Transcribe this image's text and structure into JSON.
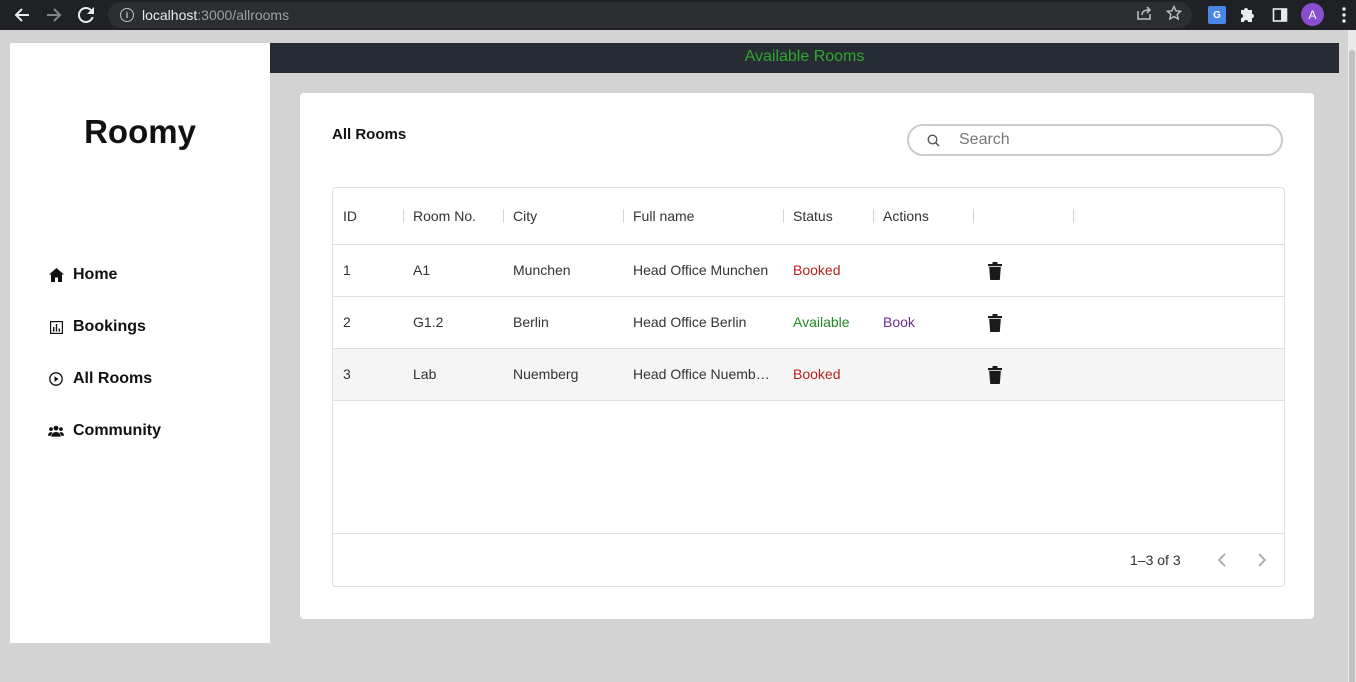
{
  "browser": {
    "url_host": "localhost",
    "url_path": ":3000/allrooms",
    "avatar_letter": "A",
    "translate_label": "G"
  },
  "sidebar": {
    "brand": "Roomy",
    "items": [
      {
        "label": "Home",
        "icon": "home-icon"
      },
      {
        "label": "Bookings",
        "icon": "bar-chart-icon"
      },
      {
        "label": "All Rooms",
        "icon": "play-circle-icon"
      },
      {
        "label": "Community",
        "icon": "people-icon"
      }
    ]
  },
  "header": {
    "title": "Available Rooms",
    "title_color": "#2ea82e"
  },
  "main": {
    "title": "All Rooms",
    "search": {
      "placeholder": "Search",
      "value": ""
    },
    "table": {
      "columns": [
        "ID",
        "Room No.",
        "City",
        "Full name",
        "Status",
        "Actions",
        ""
      ],
      "rows": [
        {
          "id": "1",
          "room": "A1",
          "city": "Munchen",
          "full_name": "Head Office Munchen",
          "status": "Booked",
          "action": ""
        },
        {
          "id": "2",
          "room": "G1.2",
          "city": "Berlin",
          "full_name": "Head Office Berlin",
          "status": "Available",
          "action": "Book"
        },
        {
          "id": "3",
          "room": "Lab",
          "city": "Nuemberg",
          "full_name": "Head Office Nuemberg",
          "status": "Booked",
          "action": ""
        }
      ]
    },
    "pagination": {
      "text": "1–3 of 3"
    }
  },
  "colors": {
    "booked": "#b22222",
    "available": "#228b22",
    "link": "#6a2c91",
    "header_bg": "#272b33"
  }
}
